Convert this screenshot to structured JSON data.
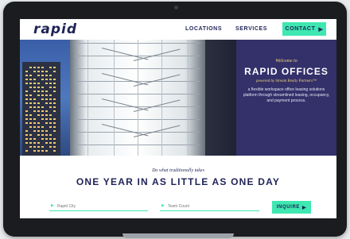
{
  "nav": {
    "logo": "rapid",
    "links": [
      "LOCATIONS",
      "SERVICES"
    ],
    "contact_label": "CONTACT",
    "contact_arrow": "▶"
  },
  "hero": {
    "kicker": "Welcome to",
    "title": "RAPID OFFICES",
    "powered_by": "powered by Stream Realty Partners™",
    "description": "a flexible workspace office leasing solutions platform through streamlined leasing, occupancy, and payment process."
  },
  "tagline": {
    "small": "Do what traditionally takes",
    "big": "ONE YEAR IN AS LITTLE AS ONE DAY"
  },
  "form": {
    "city_placeholder": "Rapid City",
    "team_placeholder": "Team Count",
    "field_chevron": "▶",
    "inquire_label": "INQUIRE",
    "inquire_arrow": "▶"
  },
  "colors": {
    "brand_navy": "#1f2357",
    "accent_mint": "#3ee8b0",
    "panel_purple": "#33306a",
    "gold": "#f3d77a"
  },
  "icons": [
    "arrow-right-icon",
    "chevron-right-icon",
    "camera-icon"
  ]
}
